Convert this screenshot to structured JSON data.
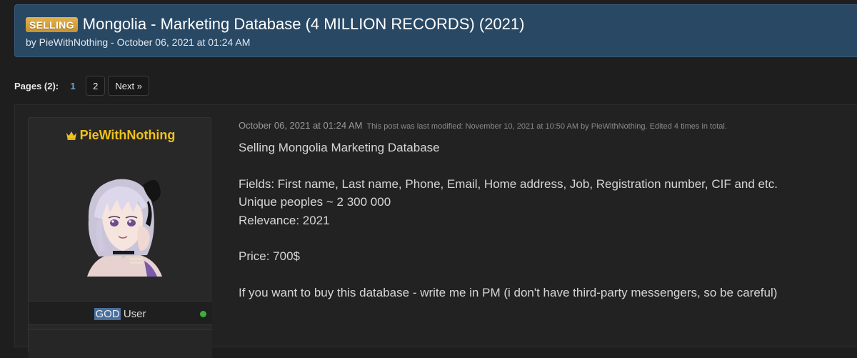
{
  "thread": {
    "prefix": "SELLING",
    "title": "Mongolia - Marketing Database (4 MILLION RECORDS) (2021)",
    "byline": "by PieWithNothing - October 06, 2021 at 01:24 AM"
  },
  "pagination": {
    "label": "Pages (2):",
    "current": "1",
    "page2": "2",
    "next": "Next »"
  },
  "author": {
    "name": "PieWithNothing",
    "title_highlight": "GOD",
    "title_rest": " User",
    "online": true,
    "name_color": "#f0c21a"
  },
  "post": {
    "date": "October 06, 2021 at 01:24 AM",
    "edited": "This post was last modified: November 10, 2021 at 10:50 AM by PieWithNothing. Edited 4 times in total.",
    "lines": {
      "l1": "Selling Mongolia Marketing Database",
      "l2": "Fields: First name, Last name, Phone, Email, Home address, Job, Registration number, CIF and etc.",
      "l3": "Unique peoples ~ 2 300 000",
      "l4": "Relevance: 2021",
      "l5": "Price: 700$",
      "l6": "If you want to buy this database - write me in PM (i don't have third-party messengers, so be careful)"
    }
  },
  "colors": {
    "header_bg": "#284864",
    "prefix_badge": "#d4a03a",
    "page_bg": "#1e1e1e",
    "link_blue": "#6fa8d8"
  }
}
